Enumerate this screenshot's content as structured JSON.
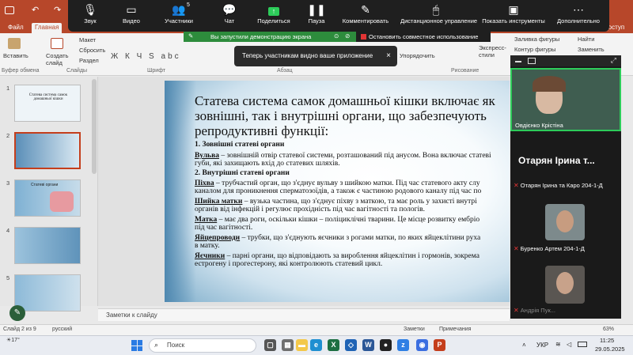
{
  "ppt": {
    "tabs": [
      "Файл",
      "Главная"
    ],
    "tab_suffix": "доступ",
    "ribbon": {
      "paste": "Вставить",
      "new_slide": "Создать слайд",
      "layout": "Макет",
      "reset": "Сбросить",
      "section": "Раздел",
      "groups": [
        "Буфер обмена",
        "Слайды",
        "Шрифт",
        "Абзац",
        "Рисование"
      ],
      "arrange": "Упорядочить",
      "quick_styles": "Экспресс-стили",
      "shape_fill": "Заливка фигуры",
      "shape_outline": "Контур фигуры",
      "find": "Найти",
      "replace": "Заменить"
    }
  },
  "zoom_toolbar": {
    "items": [
      {
        "label": "Звук",
        "icon": "microphone-icon"
      },
      {
        "label": "Видео",
        "icon": "camera-icon"
      },
      {
        "label": "Участники",
        "icon": "participants-icon",
        "badge": "5"
      },
      {
        "label": "Чат",
        "icon": "chat-icon"
      },
      {
        "label": "Поделиться",
        "icon": "share-icon"
      },
      {
        "label": "Пауза",
        "icon": "pause-icon"
      },
      {
        "label": "Комментировать",
        "icon": "annotate-icon"
      },
      {
        "label": "Дистанционное управление",
        "icon": "remote-control-icon"
      },
      {
        "label": "Показать инструменты",
        "icon": "show-tools-icon"
      },
      {
        "label": "Дополнительно",
        "icon": "more-icon"
      }
    ],
    "share_banner": "Вы запустили демонстрацию экрана",
    "stop_share": "Остановить совместное использование",
    "toast": "Теперь участникам видно ваше приложение"
  },
  "thumbnails": {
    "numbers": [
      "1",
      "2",
      "3",
      "4",
      "5"
    ],
    "slide1_title": "Статева система самок домашньої кішки",
    "slide3_title": "Статеві органи"
  },
  "slide": {
    "title": "Статева система самок домашньої кішки включає як зовнішні, так і внутрішні органи, що забезпечують репродуктивні функції:",
    "h1": "1. Зовнішні статеві органи",
    "p1_term": "Вульва",
    "p1_text": " – зовнішній отвір статевої системи, розташований під анусом. Вона включає статеві",
    "p1_text2": "губи, які захищають вхід до статевих шляхів.",
    "h2": "2. Внутрішні статеві органи",
    "p2_term": "Піхва",
    "p2_text": " – трубчастий орган, що з'єднує вульву з шийкою матки. Під час статевого акту слу",
    "p2_text2": "каналом для проникнення сперматозоїдів, а також є частиною родового каналу під час по",
    "p3_term": "Шийка матки",
    "p3_text": " – вузька частина, що з'єднує піхву з маткою, та має роль у захисті внутрі",
    "p3_text2": "органів від інфекцій і регулює прохідність під час вагітності та пологів.",
    "p4_term": "Матка",
    "p4_text": " – має два роги, оскільки кішки – поліциклічні тварини. Це місце розвитку ембріо",
    "p4_text2": "під час вагітності.",
    "p5_term": "Яйцепроводи",
    "p5_text": " – трубки, що з'єднують яєчники з рогами матки, по яких яйцеклітини руха",
    "p5_text2": "в матку.",
    "p6_term": "Яєчники",
    "p6_text": " – парні органи, що відповідають за вироблення яйцеклітин і гормонів, зокрема",
    "p6_text2": "естрогену і прогестерону, які контролюють статевий цикл."
  },
  "notes_placeholder": "Заметки к слайду",
  "status": {
    "slide_of": "Слайд 2 из 9",
    "language": "русский",
    "notes": "Заметки",
    "comments": "Примечания",
    "zoom": "63%"
  },
  "video_panel": {
    "presenter_name": "Овдієнко Крістіна",
    "big_name": "Отарян Ірина т...",
    "participants": [
      {
        "name": "Отарян Ірина та Каро 204-1-Д",
        "muted": true
      },
      {
        "name": "Буренко Артем 204-1-Д",
        "muted": true
      },
      {
        "name": "Андрія Пук...",
        "muted": true
      }
    ]
  },
  "taskbar": {
    "weather": "17°",
    "search_placeholder": "Поиск",
    "language": "УКР",
    "time": "11:25",
    "date": "29.05.2025"
  }
}
